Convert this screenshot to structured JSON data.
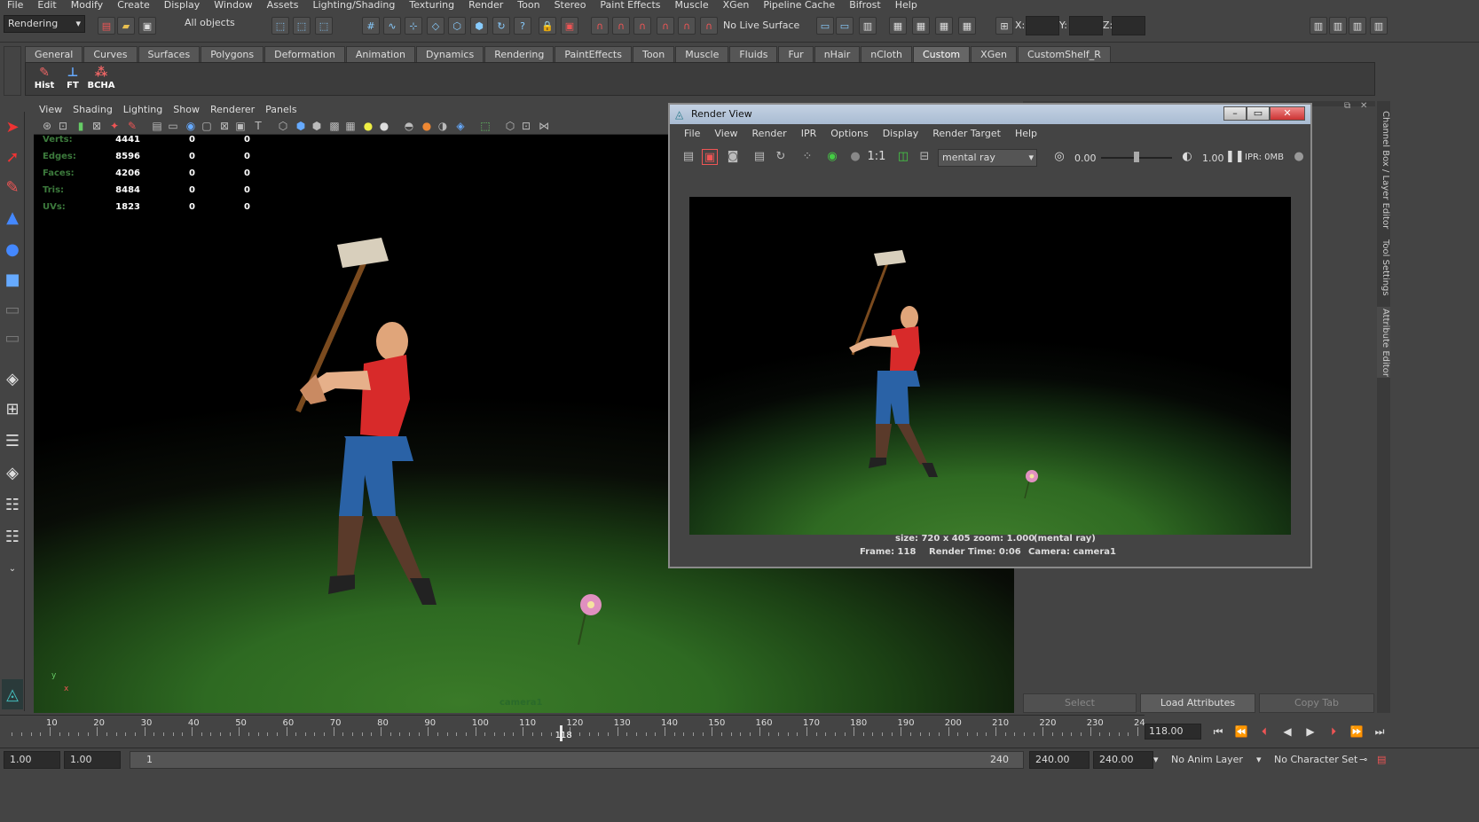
{
  "menubar": [
    "File",
    "Edit",
    "Modify",
    "Create",
    "Display",
    "Window",
    "Assets",
    "Lighting/Shading",
    "Texturing",
    "Render",
    "Toon",
    "Stereo",
    "Paint Effects",
    "Muscle",
    "XGen",
    "Pipeline Cache",
    "Bifrost",
    "Help"
  ],
  "status": {
    "mode": "Rendering",
    "selection_filter": "All objects",
    "live_surface": "No Live Surface",
    "x_label": "X:",
    "y_label": "Y:",
    "z_label": "Z:"
  },
  "shelf": {
    "tabs": [
      "General",
      "Curves",
      "Surfaces",
      "Polygons",
      "Deformation",
      "Animation",
      "Dynamics",
      "Rendering",
      "PaintEffects",
      "Toon",
      "Muscle",
      "Fluids",
      "Fur",
      "nHair",
      "nCloth",
      "Custom",
      "XGen",
      "CustomShelf_R"
    ],
    "active_tab": "Custom",
    "buttons": [
      {
        "label": "Hist",
        "icon": "history-icon"
      },
      {
        "label": "FT",
        "icon": "freeze-transform-icon"
      },
      {
        "label": "BCHA",
        "icon": "bake-channel-icon"
      }
    ]
  },
  "viewport": {
    "menu": [
      "View",
      "Shading",
      "Lighting",
      "Show",
      "Renderer",
      "Panels"
    ],
    "hud": [
      {
        "label": "Verts:",
        "v1": "4441",
        "v2": "0",
        "v3": "0"
      },
      {
        "label": "Edges:",
        "v1": "8596",
        "v2": "0",
        "v3": "0"
      },
      {
        "label": "Faces:",
        "v1": "4206",
        "v2": "0",
        "v3": "0"
      },
      {
        "label": "Tris:",
        "v1": "8484",
        "v2": "0",
        "v3": "0"
      },
      {
        "label": "UVs:",
        "v1": "1823",
        "v2": "0",
        "v3": "0"
      }
    ],
    "camera_label": "camera1",
    "axis_y": "y",
    "axis_x": "x"
  },
  "render_view": {
    "title": "Render View",
    "menu": [
      "File",
      "View",
      "Render",
      "IPR",
      "Options",
      "Display",
      "Render Target",
      "Help"
    ],
    "renderer": "mental ray",
    "exposure": "0.00",
    "gamma": "1.00",
    "ratio": "1:1",
    "ipr": "IPR: 0MB",
    "info_size": "size: 720 x 405 zoom: 1.000",
    "info_renderer": "(mental ray)",
    "info_frame": "Frame: 118",
    "info_time": "Render Time: 0:06",
    "info_camera": "Camera: camera1"
  },
  "attribute_panel": {
    "select": "Select",
    "load": "Load Attributes",
    "copy": "Copy Tab"
  },
  "side_tabs": [
    "Channel Box / Layer Editor",
    "Tool Settings",
    "Attribute Editor"
  ],
  "timeline": {
    "ticks": [
      "10",
      "20",
      "30",
      "40",
      "50",
      "60",
      "70",
      "80",
      "90",
      "100",
      "110",
      "120",
      "130",
      "140",
      "150",
      "160",
      "170",
      "180",
      "190",
      "200",
      "210",
      "220",
      "230",
      "24"
    ],
    "current_marker": "118",
    "current_frame": "118.00"
  },
  "range": {
    "start": "1.00",
    "inner_start": "1.00",
    "slider_start": "1",
    "slider_end": "240",
    "end": "240.00",
    "outer_end": "240.00",
    "anim_layer": "No Anim Layer",
    "character_set": "No Character Set"
  },
  "colors": {
    "accent_active_tab": "#666666",
    "hud_label": "#3c7a3c",
    "ground": "#2f6a22"
  }
}
